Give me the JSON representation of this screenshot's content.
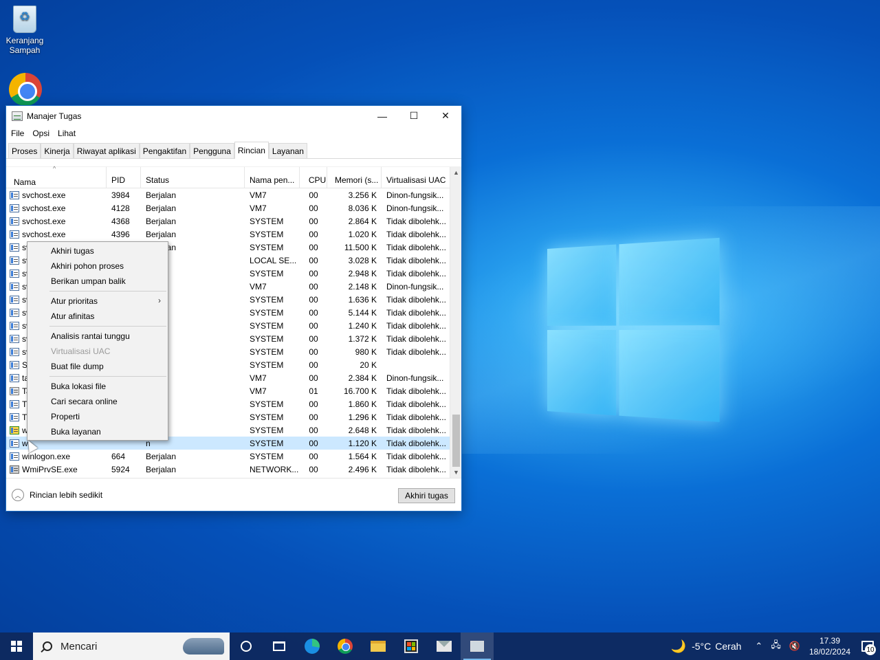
{
  "desktop": {
    "recycle_bin_label": "Keranjang Sampah",
    "chrome_shortcut_label": ""
  },
  "window": {
    "title": "Manajer Tugas",
    "minimize": "—",
    "maximize": "☐",
    "close": "✕"
  },
  "menu": {
    "file": "File",
    "options": "Opsi",
    "view": "Lihat"
  },
  "tabs": [
    {
      "label": "Proses"
    },
    {
      "label": "Kinerja"
    },
    {
      "label": "Riwayat aplikasi"
    },
    {
      "label": "Pengaktifan"
    },
    {
      "label": "Pengguna"
    },
    {
      "label": "Rincian"
    },
    {
      "label": "Layanan"
    }
  ],
  "active_tab": "Rincian",
  "columns": {
    "name": "Nama",
    "pid": "PID",
    "status": "Status",
    "user": "Nama pen...",
    "cpu": "CPU",
    "memory": "Memori (s...",
    "uac": "Virtualisasi UAC"
  },
  "rows": [
    {
      "name": "svchost.exe",
      "pid": "3984",
      "status": "Berjalan",
      "user": "VM7",
      "cpu": "00",
      "mem": "3.256 K",
      "uac": "Dinon-fungsik..."
    },
    {
      "name": "svchost.exe",
      "pid": "4128",
      "status": "Berjalan",
      "user": "VM7",
      "cpu": "00",
      "mem": "8.036 K",
      "uac": "Dinon-fungsik..."
    },
    {
      "name": "svchost.exe",
      "pid": "4368",
      "status": "Berjalan",
      "user": "SYSTEM",
      "cpu": "00",
      "mem": "2.864 K",
      "uac": "Tidak dibolehk..."
    },
    {
      "name": "svchost.exe",
      "pid": "4396",
      "status": "Berjalan",
      "user": "SYSTEM",
      "cpu": "00",
      "mem": "1.020 K",
      "uac": "Tidak dibolehk..."
    },
    {
      "name": "svchost.exe",
      "pid": "4536",
      "status": "Berjalan",
      "user": "SYSTEM",
      "cpu": "00",
      "mem": "11.500 K",
      "uac": "Tidak dibolehk..."
    },
    {
      "name": "sv",
      "pid": "",
      "status": "n",
      "user": "LOCAL SE...",
      "cpu": "00",
      "mem": "3.028 K",
      "uac": "Tidak dibolehk..."
    },
    {
      "name": "sv",
      "pid": "",
      "status": "n",
      "user": "SYSTEM",
      "cpu": "00",
      "mem": "2.948 K",
      "uac": "Tidak dibolehk..."
    },
    {
      "name": "sv",
      "pid": "",
      "status": "n",
      "user": "VM7",
      "cpu": "00",
      "mem": "2.148 K",
      "uac": "Dinon-fungsik..."
    },
    {
      "name": "sv",
      "pid": "",
      "status": "n",
      "user": "SYSTEM",
      "cpu": "00",
      "mem": "1.636 K",
      "uac": "Tidak dibolehk..."
    },
    {
      "name": "sv",
      "pid": "",
      "status": "n",
      "user": "SYSTEM",
      "cpu": "00",
      "mem": "5.144 K",
      "uac": "Tidak dibolehk..."
    },
    {
      "name": "sv",
      "pid": "",
      "status": "n",
      "user": "SYSTEM",
      "cpu": "00",
      "mem": "1.240 K",
      "uac": "Tidak dibolehk..."
    },
    {
      "name": "sv",
      "pid": "",
      "status": "n",
      "user": "SYSTEM",
      "cpu": "00",
      "mem": "1.372 K",
      "uac": "Tidak dibolehk..."
    },
    {
      "name": "sv",
      "pid": "",
      "status": "n",
      "user": "SYSTEM",
      "cpu": "00",
      "mem": "980 K",
      "uac": "Tidak dibolehk..."
    },
    {
      "name": "Sy",
      "pid": "",
      "status": "n",
      "user": "SYSTEM",
      "cpu": "00",
      "mem": "20 K",
      "uac": ""
    },
    {
      "name": "ta",
      "pid": "",
      "status": "n",
      "user": "VM7",
      "cpu": "00",
      "mem": "2.384 K",
      "uac": "Dinon-fungsik..."
    },
    {
      "name": "Ta",
      "pid": "",
      "status": "n",
      "user": "VM7",
      "cpu": "01",
      "mem": "16.700 K",
      "uac": "Tidak dibolehk..."
    },
    {
      "name": "Ti",
      "pid": "",
      "status": "n",
      "user": "SYSTEM",
      "cpu": "00",
      "mem": "1.860 K",
      "uac": "Tidak dibolehk..."
    },
    {
      "name": "Tr",
      "pid": "",
      "status": "n",
      "user": "SYSTEM",
      "cpu": "00",
      "mem": "1.296 K",
      "uac": "Tidak dibolehk..."
    },
    {
      "name": "w",
      "pid": "",
      "status": "n",
      "user": "SYSTEM",
      "cpu": "00",
      "mem": "2.648 K",
      "uac": "Tidak dibolehk..."
    },
    {
      "name": "w",
      "pid": "",
      "status": "n",
      "user": "SYSTEM",
      "cpu": "00",
      "mem": "1.120 K",
      "uac": "Tidak dibolehk..."
    },
    {
      "name": "winlogon.exe",
      "pid": "664",
      "status": "Berjalan",
      "user": "SYSTEM",
      "cpu": "00",
      "mem": "1.564 K",
      "uac": "Tidak dibolehk..."
    },
    {
      "name": "WmiPrvSE.exe",
      "pid": "5924",
      "status": "Berjalan",
      "user": "NETWORK...",
      "cpu": "00",
      "mem": "2.496 K",
      "uac": "Tidak dibolehk..."
    }
  ],
  "selected_row_index": 19,
  "footer": {
    "fewer_details": "Rincian lebih sedikit",
    "end_task": "Akhiri tugas"
  },
  "context_menu": {
    "end_task": "Akhiri tugas",
    "end_process_tree": "Akhiri pohon proses",
    "feedback": "Berikan umpan balik",
    "set_priority": "Atur prioritas",
    "set_affinity": "Atur afinitas",
    "analyze_wait_chain": "Analisis rantai tunggu",
    "uac_virtualization": "Virtualisasi UAC",
    "create_dump": "Buat file dump",
    "open_file_location": "Buka lokasi file",
    "search_online": "Cari secara online",
    "properties": "Properti",
    "go_to_services": "Buka layanan"
  },
  "taskbar": {
    "search_placeholder": "Mencari",
    "weather_temp": "-5°C",
    "weather_condition": "Cerah",
    "time": "17.39",
    "date": "18/02/2024",
    "notification_count": "10"
  }
}
